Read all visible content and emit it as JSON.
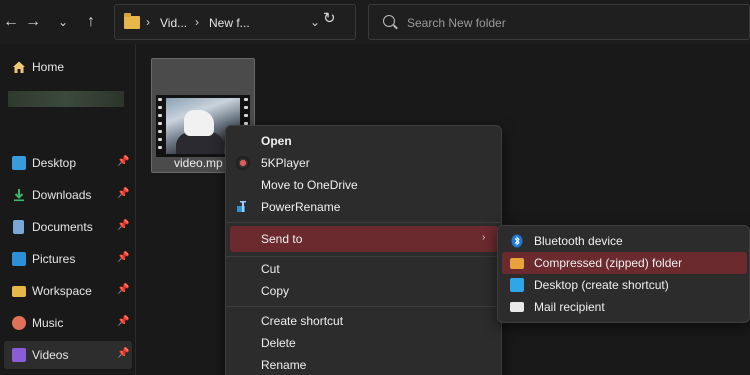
{
  "toolbar": {
    "back_icon": "arrow-left-icon",
    "forward_icon": "arrow-right-icon",
    "dropdown_icon": "chevron-down-icon",
    "up_icon": "arrow-up-icon",
    "refresh_icon": "refresh-icon"
  },
  "address_bar": {
    "crumbs": [
      "Vid...",
      "New f..."
    ]
  },
  "search": {
    "placeholder": "Search New folder"
  },
  "sidebar": {
    "home": "Home",
    "items": [
      {
        "label": "Desktop",
        "icon": "desktop-icon",
        "color": "#3a9bdc"
      },
      {
        "label": "Downloads",
        "icon": "download-icon",
        "color": "#3fb76b"
      },
      {
        "label": "Documents",
        "icon": "document-icon",
        "color": "#7aa7d6"
      },
      {
        "label": "Pictures",
        "icon": "pictures-icon",
        "color": "#2f8fd6"
      },
      {
        "label": "Workspace",
        "icon": "folder-icon",
        "color": "#e6b84a"
      },
      {
        "label": "Music",
        "icon": "music-icon",
        "color": "#e0705a"
      },
      {
        "label": "Videos",
        "icon": "videos-icon",
        "color": "#8a5cd6"
      }
    ]
  },
  "file": {
    "name": "video.mp"
  },
  "context_menu": {
    "open": "Open",
    "fivekplayer": "5KPlayer",
    "move_onedrive": "Move to OneDrive",
    "powerrename": "PowerRename",
    "send_to": "Send to",
    "cut": "Cut",
    "copy": "Copy",
    "create_shortcut": "Create shortcut",
    "delete": "Delete",
    "rename": "Rename"
  },
  "send_to_menu": {
    "bluetooth": "Bluetooth device",
    "compressed": "Compressed (zipped) folder",
    "desktop_shortcut": "Desktop (create shortcut)",
    "mail": "Mail recipient"
  },
  "colors": {
    "accent_highlight": "#6b2a2e",
    "menu_bg": "#2c2c2c"
  }
}
